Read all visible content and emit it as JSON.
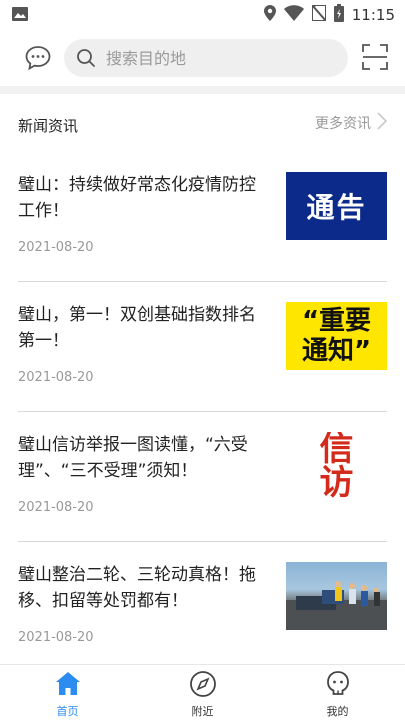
{
  "status_bar": {
    "time": "11:15",
    "icons": [
      "image-icon",
      "location-icon",
      "wifi-icon",
      "no-sim-icon",
      "battery-icon"
    ]
  },
  "header": {
    "chat_icon": "chat-bubble-icon",
    "search_placeholder": "搜索目的地",
    "scan_icon": "scan-icon"
  },
  "section": {
    "title": "新闻资讯",
    "more_label": "更多资讯"
  },
  "news": [
    {
      "title": "璧山：持续做好常态化疫情防控工作！",
      "date": "2021-08-20",
      "thumb_text": "通告"
    },
    {
      "title": "璧山，第一！双创基础指数排名第一！",
      "date": "2021-08-20",
      "thumb_text_1": "“重要",
      "thumb_text_2": "通知”"
    },
    {
      "title": "璧山信访举报一图读懂，“六受理”、“三不受理”须知！",
      "date": "2021-08-20",
      "thumb_text_1": "信",
      "thumb_text_2": "访"
    },
    {
      "title": "璧山整治二轮、三轮动真格！拖移、扣留等处罚都有！",
      "date": "2021-08-20"
    }
  ],
  "bottom_nav": [
    {
      "label": "首页",
      "icon": "home-icon",
      "active": true
    },
    {
      "label": "附近",
      "icon": "compass-icon",
      "active": false
    },
    {
      "label": "我的",
      "icon": "user-icon",
      "active": false
    }
  ],
  "colors": {
    "accent": "#2d8cf0",
    "divider": "#d8d8d8",
    "muted_text": "#999999"
  }
}
